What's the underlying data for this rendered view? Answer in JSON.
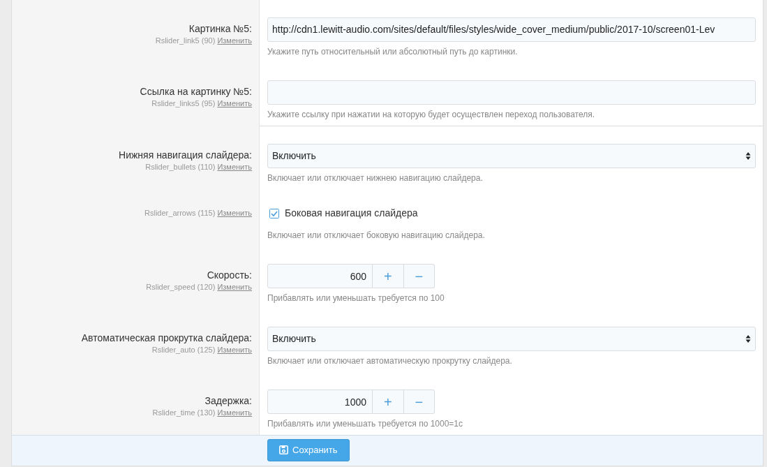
{
  "fields": [
    {
      "kind": "text",
      "label": "Картинка №5:",
      "key": "Rslider_link5 (90)",
      "link": "Изменить",
      "value": "http://cdn1.lewitt-audio.com/sites/default/files/styles/wide_cover_medium/public/2017-10/screen01-Lev",
      "help": "Укажите путь относительный или абсолютный путь до картинки.",
      "divider_after": false
    },
    {
      "kind": "text",
      "label": "Ссылка на картинку №5:",
      "key": "Rslider_links5 (95)",
      "link": "Изменить",
      "help": "Укажите ссылку при нажатии на которую будет осуществлен переход пользователя.",
      "divider_after": true
    },
    {
      "kind": "select",
      "label": "Нижняя навигация слайдера:",
      "key": "Rslider_bullets (110)",
      "link": "Изменить",
      "value": "Включить",
      "help": "Включает или отключает нижнею навигацию слайдера.",
      "divider_after": false
    },
    {
      "kind": "checkbox",
      "key": "Rslider_arrows (115)",
      "link": "Изменить",
      "text": "Боковая навигация слайдера",
      "checked": true,
      "help": "Включает или отключает боковую навигацию слайдера.",
      "divider_after": false
    },
    {
      "kind": "number",
      "label": "Скорость:",
      "key": "Rslider_speed (120)",
      "link": "Изменить",
      "value": "600",
      "plus": "+",
      "minus": "−",
      "help": "Прибавлять или уменьшать требуется по 100",
      "divider_after": false
    },
    {
      "kind": "select",
      "label": "Автоматическая прокрутка слайдера:",
      "key": "Rslider_auto (125)",
      "link": "Изменить",
      "value": "Включить",
      "help": "Включает или отключает автоматическую прокрутку слайдера.",
      "divider_after": false
    },
    {
      "kind": "number",
      "label": "Задержка:",
      "key": "Rslider_time (130)",
      "link": "Изменить",
      "value": "1000",
      "plus": "+",
      "minus": "−",
      "help": "Прибавлять или уменьшать требуется по 1000=1с",
      "divider_after": false
    }
  ],
  "save_button": {
    "label": "Сохранить"
  }
}
